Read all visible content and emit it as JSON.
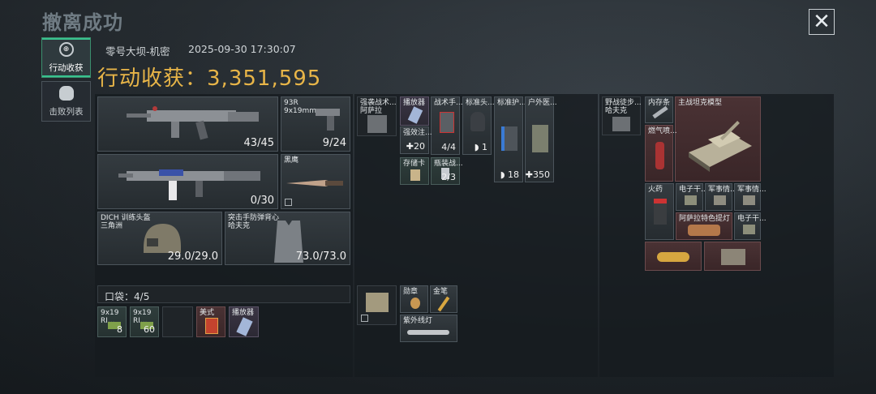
{
  "header": {
    "title": "撤离成功",
    "close_icon": "close-icon"
  },
  "tabs": [
    {
      "label": "行动收获",
      "icon": "loot-icon",
      "active": true
    },
    {
      "label": "击败列表",
      "icon": "skull-icon",
      "active": false
    }
  ],
  "session": {
    "map": "零号大坝-机密",
    "datetime": "2025-09-30 17:30:07"
  },
  "loot": {
    "label": "行动收获：",
    "value": "3,351,595"
  },
  "weapons": {
    "primary1": {
      "ammo": "43/45"
    },
    "secondary": {
      "name": "93R",
      "caliber": "9x19mm",
      "ammo": "9/24"
    },
    "primary2": {
      "ammo": "0/30"
    },
    "melee": {
      "name": "黑鹰"
    }
  },
  "armor": {
    "helmet": {
      "name": "DICH 训练头盔",
      "sub": "三角洲",
      "durability": "29.0/29.0"
    },
    "vest": {
      "name": "突击手防弹背心",
      "sub": "哈夫克",
      "durability": "73.0/73.0"
    }
  },
  "pocket": {
    "label": "口袋：",
    "count": "4/5",
    "items": [
      {
        "name": "9x19",
        "sub": "RI...",
        "count": "8"
      },
      {
        "name": "9x19",
        "sub": "RI...",
        "count": "60"
      },
      {
        "name": "",
        "count": ""
      },
      {
        "name": "美式",
        "count": ""
      },
      {
        "name": "播放器",
        "count": ""
      }
    ]
  },
  "rig": {
    "items": [
      {
        "name": "强袭战术...\n阿萨拉",
        "count": ""
      },
      {
        "name": "播放器",
        "count": ""
      },
      {
        "name": "战术手...",
        "count": ""
      },
      {
        "name": "标准头...",
        "count": ""
      },
      {
        "name": "标准护...",
        "count": ""
      },
      {
        "name": "户外医...",
        "count": ""
      },
      {
        "name": "强效注...",
        "count": "20"
      },
      {
        "name": "",
        "count": "4/4"
      },
      {
        "name": "",
        "count": "1"
      },
      {
        "name": "",
        "count": "18"
      },
      {
        "name": "",
        "count": "350"
      },
      {
        "name": "存储卡",
        "count": ""
      },
      {
        "name": "瓶装战...",
        "count": "2/3"
      }
    ]
  },
  "backpack": {
    "items": [
      {
        "name": "勋章",
        "count": ""
      },
      {
        "name": "金笔",
        "count": ""
      },
      {
        "name": "紫外线灯",
        "count": ""
      }
    ]
  },
  "case": {
    "bag": {
      "name": "野战徒步...\n哈夫克"
    },
    "items": [
      {
        "name": "内存条"
      },
      {
        "name": "主战坦克模型"
      },
      {
        "name": "燃气喷..."
      },
      {
        "name": "火药"
      },
      {
        "name": "电子干..."
      },
      {
        "name": "军事情..."
      },
      {
        "name": "军事情..."
      },
      {
        "name": "电子干..."
      },
      {
        "name": "阿萨拉特色提灯"
      },
      {
        "name": "电子干..."
      }
    ]
  }
}
